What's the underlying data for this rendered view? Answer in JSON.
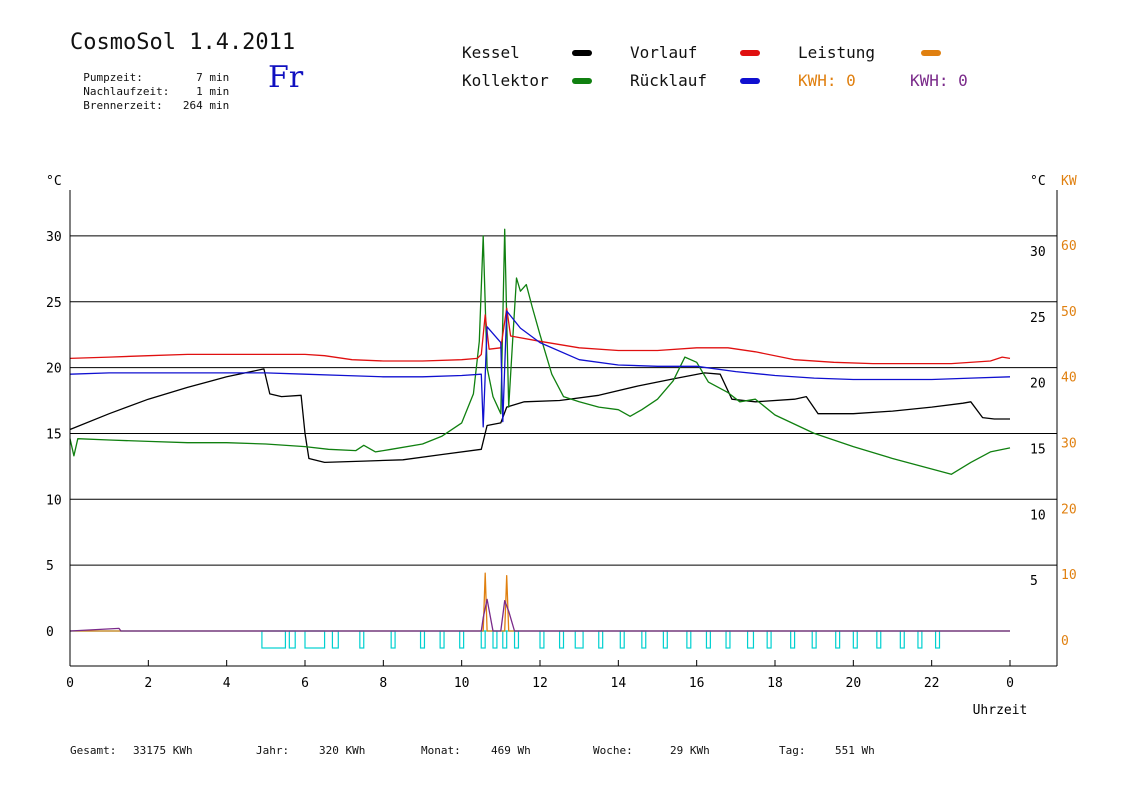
{
  "header": {
    "title": "CosmoSol 1.4.2011",
    "day": "Fr",
    "info": [
      {
        "label": "Pumpzeit:",
        "value": "7 min"
      },
      {
        "label": "Nachlaufzeit:",
        "value": "1 min"
      },
      {
        "label": "Brennerzeit:",
        "value": "264 min"
      }
    ]
  },
  "legend": {
    "kessel": "Kessel",
    "kollektor": "Kollektor",
    "vorlauf": "Vorlauf",
    "ruecklauf": "Rücklauf",
    "leistung": "Leistung",
    "kwh_orange": "KWH: 0",
    "kwh_purple": "KWH: 0"
  },
  "footer": {
    "gesamt_label": "Gesamt:",
    "gesamt_value": "33175 KWh",
    "jahr_label": "Jahr:",
    "jahr_value": "320 KWh",
    "monat_label": "Monat:",
    "monat_value": "469 Wh",
    "woche_label": "Woche:",
    "woche_value": "29 KWh",
    "tag_label": "Tag:",
    "tag_value": "551 Wh"
  },
  "colors": {
    "kessel": "#000000",
    "kollektor": "#108010",
    "vorlauf": "#e01010",
    "ruecklauf": "#1010d0",
    "leistung": "#e08010",
    "kwh": "#7a2a8a",
    "pump": "#00d0d0"
  },
  "chart_data": {
    "type": "line",
    "xlabel": "Uhrzeit",
    "ylabel_left": "°C",
    "ylabel_right": "°C",
    "ylabel_right2": "KW",
    "xlim": [
      0,
      24
    ],
    "ylim": [
      -2.5,
      35
    ],
    "x_ticks": [
      0,
      2,
      4,
      6,
      8,
      10,
      12,
      14,
      16,
      18,
      20,
      22,
      24
    ],
    "x_tick_labels": [
      "0",
      "2",
      "4",
      "6",
      "8",
      "10",
      "12",
      "14",
      "16",
      "18",
      "20",
      "22",
      "0"
    ],
    "y_left_ticks": [
      0,
      5,
      10,
      15,
      20,
      25,
      30
    ],
    "y_left_labels": [
      "0",
      "5",
      "10",
      "15",
      "20",
      "25",
      "30"
    ],
    "y_right_ticks": [
      5,
      10,
      15,
      20,
      25,
      30
    ],
    "y_right_labels": [
      "5",
      "10",
      "15",
      "20",
      "25",
      "30"
    ],
    "kw_ticks": [
      0,
      10,
      20,
      30,
      40,
      50,
      60
    ],
    "kw_labels": [
      "0",
      "10",
      "20",
      "30",
      "40",
      "50",
      "60"
    ],
    "gridlines": [
      5,
      10,
      15,
      20,
      25,
      30
    ],
    "series": [
      {
        "name": "Kessel",
        "key": "kessel",
        "points": [
          [
            0,
            15.3
          ],
          [
            1,
            16.5
          ],
          [
            2,
            17.6
          ],
          [
            3,
            18.5
          ],
          [
            4,
            19.3
          ],
          [
            4.95,
            19.9
          ],
          [
            5.1,
            18.0
          ],
          [
            5.4,
            17.8
          ],
          [
            5.9,
            17.9
          ],
          [
            6.0,
            15.0
          ],
          [
            6.1,
            13.1
          ],
          [
            6.5,
            12.8
          ],
          [
            7.5,
            12.9
          ],
          [
            8.5,
            13.0
          ],
          [
            9.5,
            13.4
          ],
          [
            10.5,
            13.8
          ],
          [
            10.65,
            15.6
          ],
          [
            11.0,
            15.8
          ],
          [
            11.15,
            17.0
          ],
          [
            11.6,
            17.4
          ],
          [
            12.5,
            17.5
          ],
          [
            13.5,
            17.9
          ],
          [
            14.5,
            18.6
          ],
          [
            15.5,
            19.2
          ],
          [
            16.2,
            19.6
          ],
          [
            16.6,
            19.5
          ],
          [
            16.9,
            17.6
          ],
          [
            17.5,
            17.4
          ],
          [
            18.5,
            17.6
          ],
          [
            18.8,
            17.8
          ],
          [
            19.1,
            16.5
          ],
          [
            20,
            16.5
          ],
          [
            21,
            16.7
          ],
          [
            22,
            17.0
          ],
          [
            22.8,
            17.3
          ],
          [
            23.0,
            17.4
          ],
          [
            23.3,
            16.2
          ],
          [
            23.6,
            16.1
          ],
          [
            24,
            16.1
          ]
        ]
      },
      {
        "name": "Kollektor",
        "key": "kollektor",
        "points": [
          [
            0,
            14.6
          ],
          [
            0.1,
            13.3
          ],
          [
            0.2,
            14.6
          ],
          [
            1,
            14.5
          ],
          [
            2,
            14.4
          ],
          [
            3,
            14.3
          ],
          [
            4,
            14.3
          ],
          [
            5,
            14.2
          ],
          [
            6,
            14.0
          ],
          [
            6.6,
            13.8
          ],
          [
            7.3,
            13.7
          ],
          [
            7.5,
            14.1
          ],
          [
            7.8,
            13.6
          ],
          [
            8.2,
            13.8
          ],
          [
            9,
            14.2
          ],
          [
            9.5,
            14.8
          ],
          [
            10,
            15.8
          ],
          [
            10.3,
            18.0
          ],
          [
            10.45,
            22.0
          ],
          [
            10.55,
            30.0
          ],
          [
            10.65,
            20.0
          ],
          [
            10.8,
            17.8
          ],
          [
            11.0,
            16.5
          ],
          [
            11.1,
            30.5
          ],
          [
            11.2,
            17.0
          ],
          [
            11.3,
            22.0
          ],
          [
            11.4,
            26.8
          ],
          [
            11.5,
            25.8
          ],
          [
            11.65,
            26.3
          ],
          [
            11.8,
            24.6
          ],
          [
            12.0,
            22.5
          ],
          [
            12.3,
            19.5
          ],
          [
            12.6,
            17.8
          ],
          [
            13.0,
            17.4
          ],
          [
            13.5,
            17.0
          ],
          [
            14.0,
            16.8
          ],
          [
            14.3,
            16.3
          ],
          [
            14.6,
            16.8
          ],
          [
            15.0,
            17.6
          ],
          [
            15.4,
            19.0
          ],
          [
            15.7,
            20.8
          ],
          [
            16.0,
            20.4
          ],
          [
            16.3,
            18.9
          ],
          [
            16.8,
            18.1
          ],
          [
            17.1,
            17.4
          ],
          [
            17.5,
            17.6
          ],
          [
            18.0,
            16.4
          ],
          [
            19.0,
            15.0
          ],
          [
            20.0,
            14.0
          ],
          [
            21.0,
            13.1
          ],
          [
            22.0,
            12.3
          ],
          [
            22.5,
            11.9
          ],
          [
            23.0,
            12.8
          ],
          [
            23.5,
            13.6
          ],
          [
            24,
            13.9
          ]
        ]
      },
      {
        "name": "Vorlauf",
        "key": "vorlauf",
        "points": [
          [
            0,
            20.7
          ],
          [
            1,
            20.8
          ],
          [
            2,
            20.9
          ],
          [
            3,
            21.0
          ],
          [
            4,
            21.0
          ],
          [
            5,
            21.0
          ],
          [
            6,
            21.0
          ],
          [
            6.5,
            20.9
          ],
          [
            7.2,
            20.6
          ],
          [
            8,
            20.5
          ],
          [
            9,
            20.5
          ],
          [
            10,
            20.6
          ],
          [
            10.4,
            20.7
          ],
          [
            10.5,
            21.0
          ],
          [
            10.6,
            24.0
          ],
          [
            10.7,
            21.4
          ],
          [
            11.0,
            21.5
          ],
          [
            11.15,
            24.5
          ],
          [
            11.25,
            22.4
          ],
          [
            12,
            22.0
          ],
          [
            13,
            21.5
          ],
          [
            14,
            21.3
          ],
          [
            15,
            21.3
          ],
          [
            16,
            21.5
          ],
          [
            16.8,
            21.5
          ],
          [
            17.5,
            21.2
          ],
          [
            18.5,
            20.6
          ],
          [
            19.5,
            20.4
          ],
          [
            20.5,
            20.3
          ],
          [
            21.5,
            20.3
          ],
          [
            22.5,
            20.3
          ],
          [
            23.5,
            20.5
          ],
          [
            23.8,
            20.8
          ],
          [
            24,
            20.7
          ]
        ]
      },
      {
        "name": "Rücklauf",
        "key": "ruecklauf",
        "points": [
          [
            0,
            19.5
          ],
          [
            1,
            19.6
          ],
          [
            2,
            19.6
          ],
          [
            3,
            19.6
          ],
          [
            4,
            19.6
          ],
          [
            5,
            19.6
          ],
          [
            6,
            19.5
          ],
          [
            7,
            19.4
          ],
          [
            8,
            19.3
          ],
          [
            9,
            19.3
          ],
          [
            10,
            19.4
          ],
          [
            10.5,
            19.5
          ],
          [
            10.55,
            15.5
          ],
          [
            10.65,
            23.1
          ],
          [
            11.0,
            21.9
          ],
          [
            11.05,
            15.9
          ],
          [
            11.15,
            24.3
          ],
          [
            11.5,
            23.0
          ],
          [
            12,
            21.9
          ],
          [
            13,
            20.6
          ],
          [
            14,
            20.2
          ],
          [
            15,
            20.1
          ],
          [
            16,
            20.1
          ],
          [
            17,
            19.7
          ],
          [
            18,
            19.4
          ],
          [
            19,
            19.2
          ],
          [
            20,
            19.1
          ],
          [
            21,
            19.1
          ],
          [
            22,
            19.1
          ],
          [
            23,
            19.2
          ],
          [
            24,
            19.3
          ]
        ]
      },
      {
        "name": "Leistung",
        "key": "leistung",
        "points": [
          [
            0,
            0
          ],
          [
            10.55,
            0
          ],
          [
            10.6,
            4.4
          ],
          [
            10.65,
            0
          ],
          [
            11.1,
            0
          ],
          [
            11.15,
            4.2
          ],
          [
            11.2,
            0
          ],
          [
            24,
            0
          ]
        ]
      },
      {
        "name": "KWH",
        "key": "kwh",
        "points": [
          [
            0,
            0
          ],
          [
            1.25,
            0.2
          ],
          [
            1.3,
            0
          ],
          [
            10.5,
            0
          ],
          [
            10.55,
            1.0
          ],
          [
            10.65,
            2.4
          ],
          [
            10.8,
            0
          ],
          [
            11.0,
            0
          ],
          [
            11.1,
            2.3
          ],
          [
            11.2,
            1.5
          ],
          [
            11.35,
            0
          ],
          [
            24,
            0
          ]
        ]
      }
    ],
    "pump_pulses": [
      [
        4.9,
        5.5
      ],
      [
        5.6,
        5.75
      ],
      [
        6.0,
        6.5
      ],
      [
        6.7,
        6.85
      ],
      [
        7.4,
        7.5
      ],
      [
        8.2,
        8.3
      ],
      [
        8.95,
        9.05
      ],
      [
        9.45,
        9.55
      ],
      [
        9.95,
        10.05
      ],
      [
        10.5,
        10.6
      ],
      [
        10.8,
        10.9
      ],
      [
        11.05,
        11.15
      ],
      [
        11.35,
        11.45
      ],
      [
        12.0,
        12.1
      ],
      [
        12.5,
        12.6
      ],
      [
        12.9,
        13.1
      ],
      [
        13.5,
        13.6
      ],
      [
        14.05,
        14.15
      ],
      [
        14.6,
        14.7
      ],
      [
        15.15,
        15.25
      ],
      [
        15.75,
        15.85
      ],
      [
        16.25,
        16.35
      ],
      [
        16.75,
        16.85
      ],
      [
        17.3,
        17.45
      ],
      [
        17.8,
        17.9
      ],
      [
        18.4,
        18.5
      ],
      [
        18.95,
        19.05
      ],
      [
        19.55,
        19.65
      ],
      [
        20.0,
        20.1
      ],
      [
        20.6,
        20.7
      ],
      [
        21.2,
        21.3
      ],
      [
        21.65,
        21.75
      ],
      [
        22.1,
        22.2
      ]
    ]
  }
}
